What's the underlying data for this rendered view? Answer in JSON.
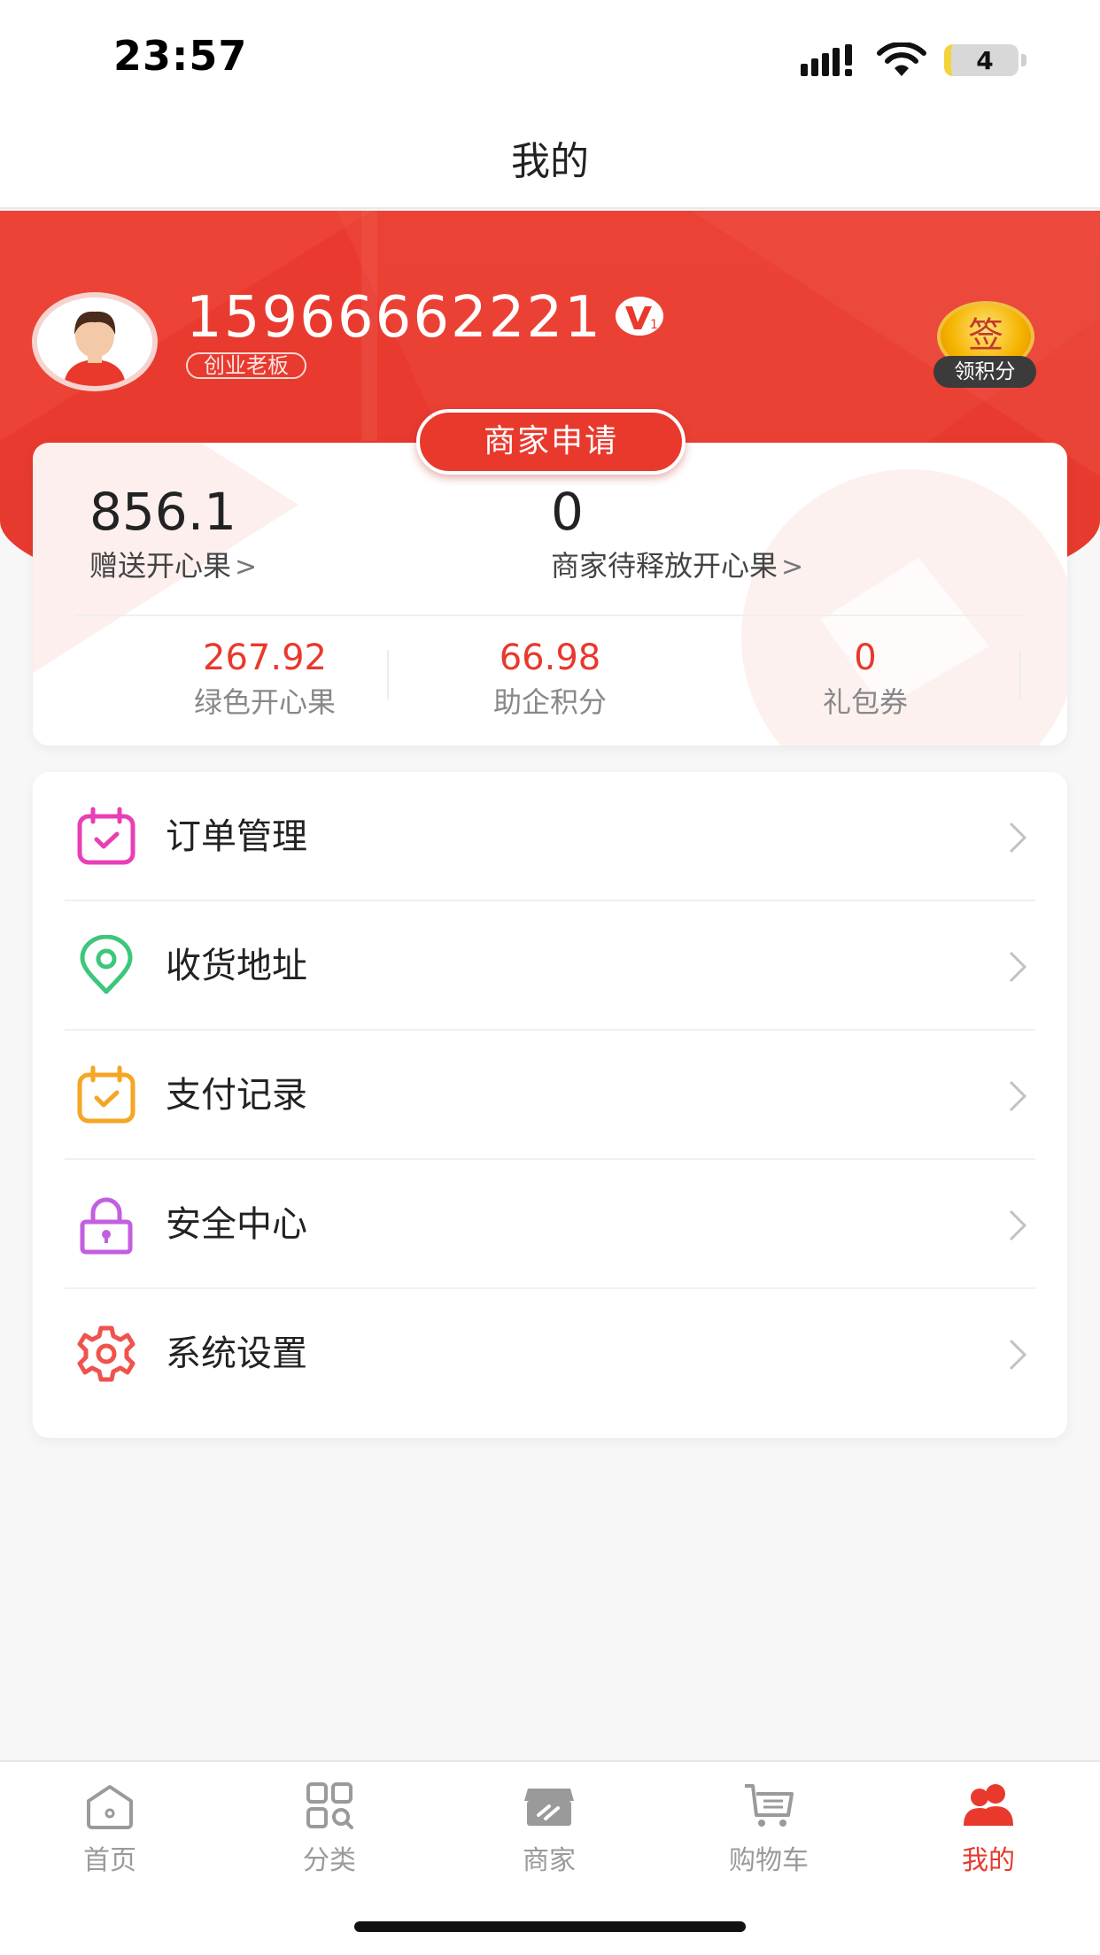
{
  "status_bar": {
    "time": "23:57",
    "battery_level": "4",
    "icons": [
      "signal-icon",
      "wifi-icon",
      "battery-icon"
    ]
  },
  "nav": {
    "title": "我的"
  },
  "profile": {
    "phone": "15966662221",
    "role": "创业老板",
    "vip_badge_icon": "vip-level-1-badge",
    "signin_char": "签",
    "signin_label": "领积分"
  },
  "merchant_apply_label": "商家申请",
  "stats": {
    "gift_value": "856.1",
    "gift_label": "赠送开心果",
    "merchant_pending_value": "0",
    "merchant_pending_label": "商家待释放开心果",
    "chevron": ">",
    "columns": [
      {
        "value": "267.92",
        "label": "绿色开心果"
      },
      {
        "value": "66.98",
        "label": "助企积分"
      },
      {
        "value": "0",
        "label": "礼包券"
      }
    ]
  },
  "menu": [
    {
      "label": "订单管理",
      "icon": "order-calendar-icon",
      "color": "#e93fb6"
    },
    {
      "label": "收货地址",
      "icon": "location-pin-icon",
      "color": "#3cc77a"
    },
    {
      "label": "支付记录",
      "icon": "payment-calendar-icon",
      "color": "#f5a623"
    },
    {
      "label": "安全中心",
      "icon": "lock-icon",
      "color": "#c45ee0"
    },
    {
      "label": "系统设置",
      "icon": "gear-icon",
      "color": "#f0524c"
    }
  ],
  "tabs": [
    {
      "label": "首页",
      "icon": "home-icon",
      "active": false
    },
    {
      "label": "分类",
      "icon": "category-grid-icon",
      "active": false
    },
    {
      "label": "商家",
      "icon": "store-icon",
      "active": false
    },
    {
      "label": "购物车",
      "icon": "cart-icon",
      "active": false
    },
    {
      "label": "我的",
      "icon": "users-icon",
      "active": true
    }
  ],
  "colors": {
    "primary_red": "#e8392c",
    "tab_inactive": "#9a9a9a",
    "background": "#f7f7f7"
  }
}
